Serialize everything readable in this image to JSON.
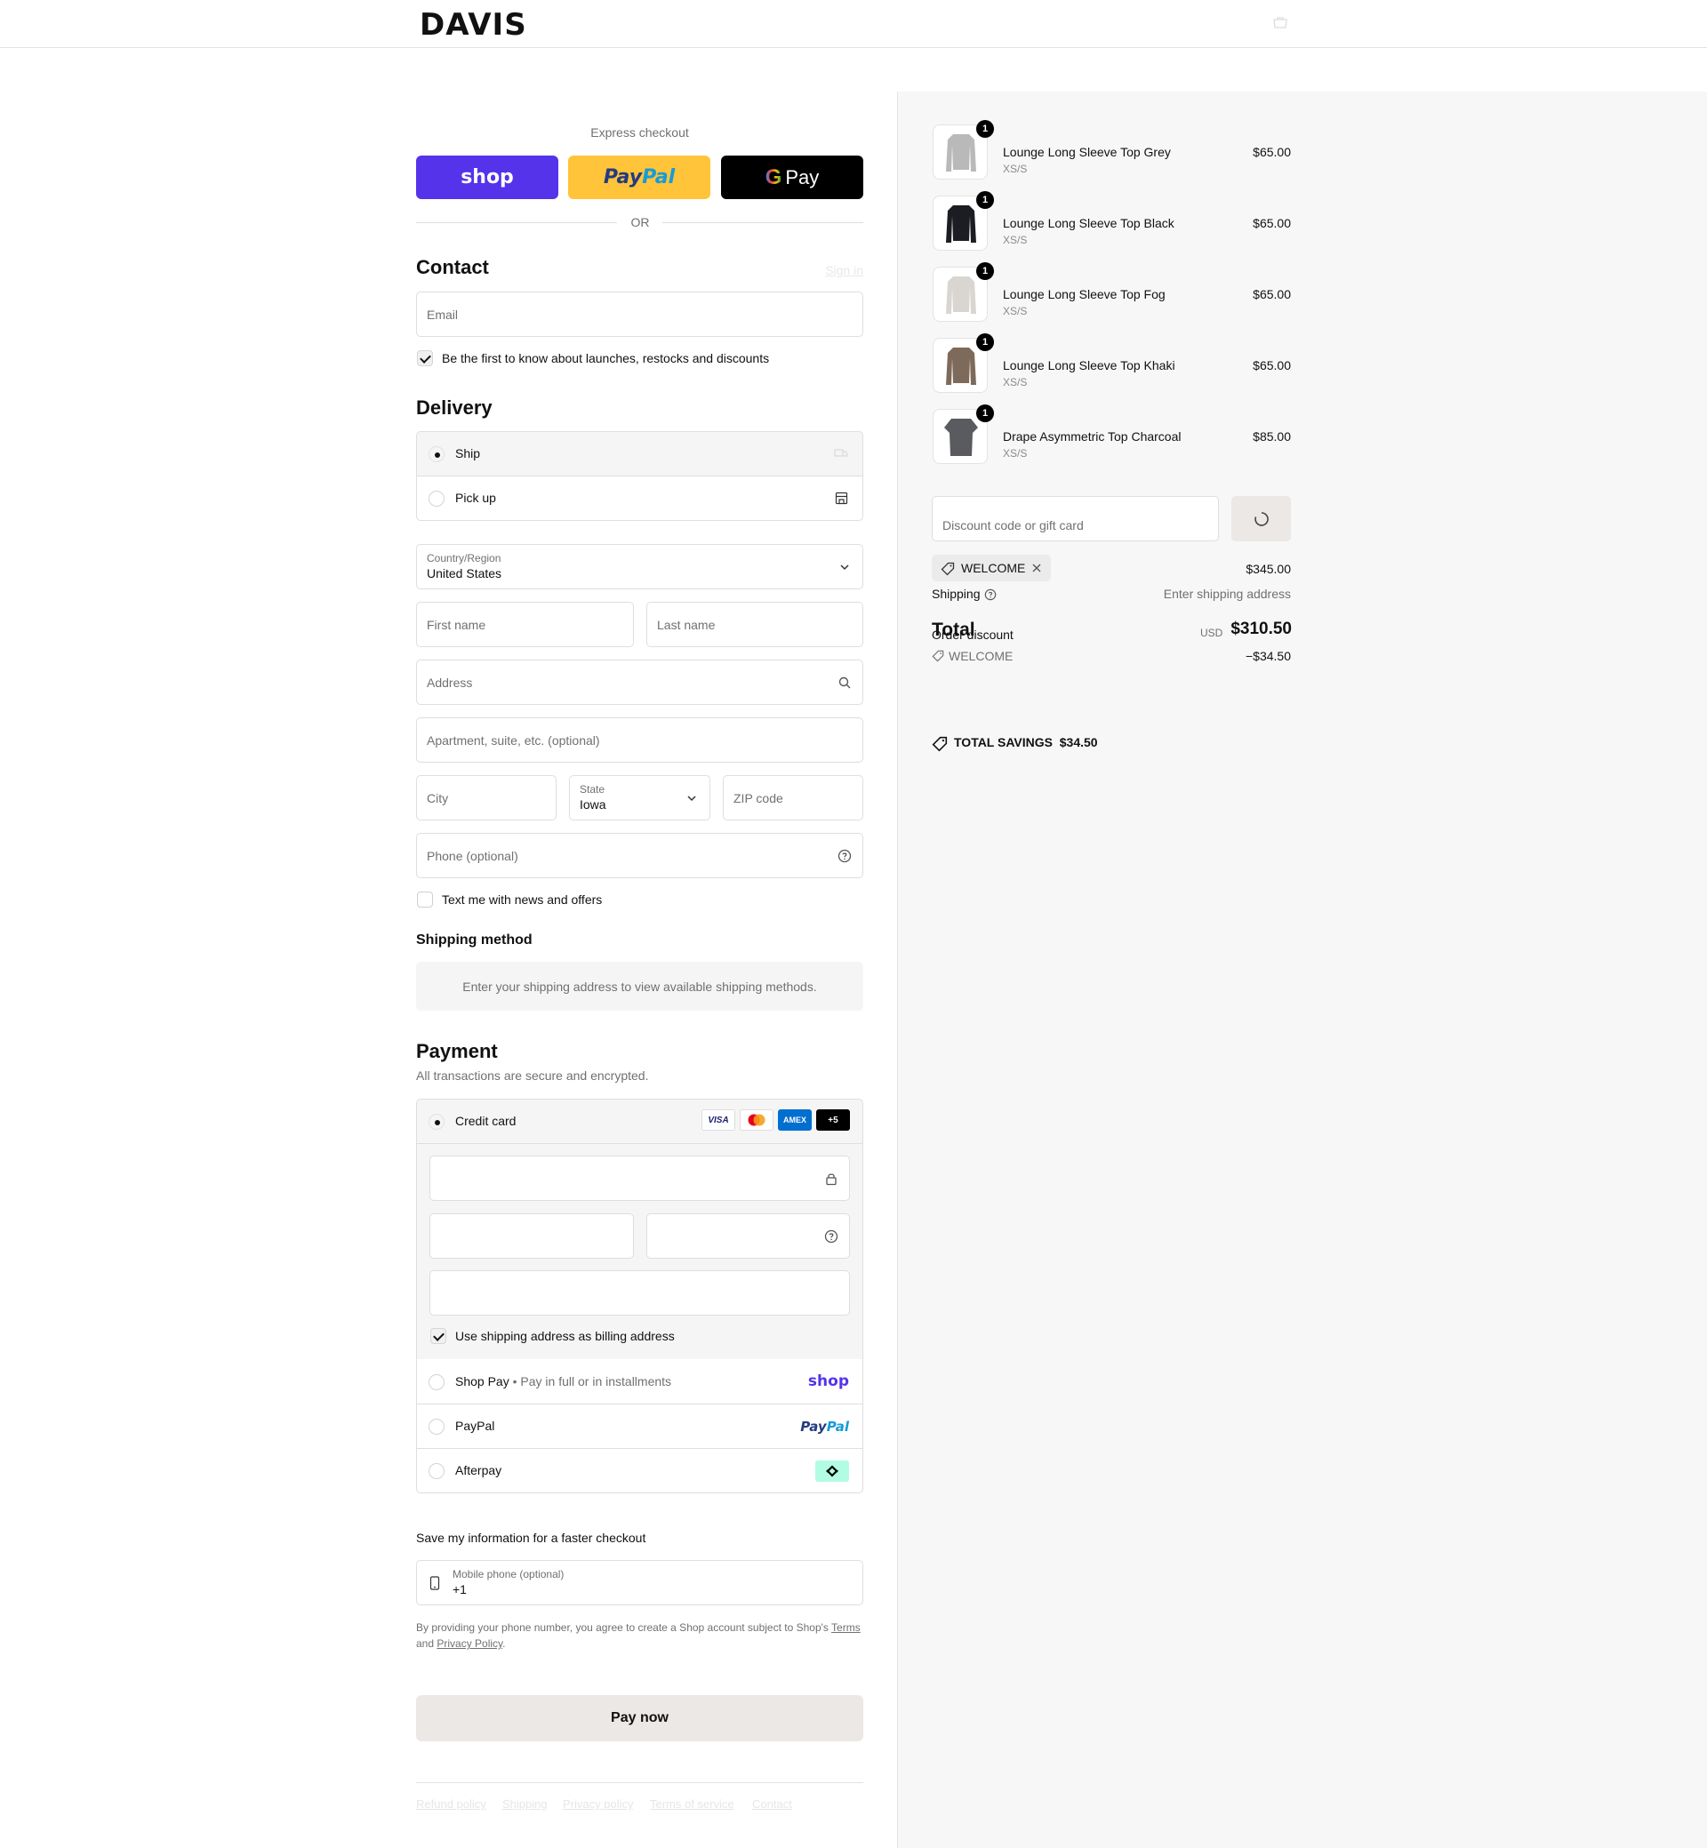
{
  "brand": "DAVIS",
  "express": {
    "title": "Express checkout",
    "shop_label": "shop",
    "paypal_label_1": "Pay",
    "paypal_label_2": "Pal",
    "gpay_g": "G",
    "gpay_label": "Pay",
    "or": "OR"
  },
  "contact": {
    "heading": "Contact",
    "sign_in": "Sign in",
    "email_placeholder": "Email",
    "newsletter_label": "Be the first to know about launches, restocks and discounts",
    "newsletter_checked": true
  },
  "delivery": {
    "heading": "Delivery",
    "options": [
      {
        "label": "Ship",
        "selected": true,
        "icon": "truck-icon"
      },
      {
        "label": "Pick up",
        "selected": false,
        "icon": "store-icon"
      }
    ],
    "country_label": "Country/Region",
    "country_value": "United States",
    "first_name_placeholder": "First name",
    "last_name_placeholder": "Last name",
    "address_placeholder": "Address",
    "apartment_placeholder": "Apartment, suite, etc. (optional)",
    "city_placeholder": "City",
    "state_label": "State",
    "state_value": "Iowa",
    "zip_placeholder": "ZIP code",
    "phone_placeholder": "Phone (optional)",
    "sms_label": "Text me with news and offers",
    "sms_checked": false
  },
  "shipping_method": {
    "heading": "Shipping method",
    "notice": "Enter your shipping address to view available shipping methods."
  },
  "payment": {
    "heading": "Payment",
    "subtitle": "All transactions are secure and encrypted.",
    "credit_card_label": "Credit card",
    "card_brands": [
      "VISA",
      "mastercard",
      "AMEX",
      "+5"
    ],
    "billing_same_label": "Use shipping address as billing address",
    "billing_same_checked": true,
    "shop_pay_label": "Shop Pay",
    "shop_pay_sub": "Pay in full or in installments",
    "shop_pay_logo": "shop",
    "paypal_label": "PayPal",
    "paypal_logo_1": "Pay",
    "paypal_logo_2": "Pal",
    "afterpay_label": "Afterpay",
    "afterpay_icon": "afterpay-icon"
  },
  "save_info": {
    "heading": "Save my information for a faster checkout",
    "mobile_label": "Mobile phone (optional)",
    "mobile_value": "+1",
    "legal_1": "By providing your phone number, you agree to create a Shop account subject to Shop's ",
    "terms": "Terms",
    "legal_2": "and ",
    "privacy": "Privacy Policy",
    "legal_3": "."
  },
  "pay_now": "Pay now",
  "footer_links": [
    "Refund policy",
    "Shipping",
    "Privacy policy",
    "Terms of service",
    "Contact"
  ],
  "summary": {
    "items": [
      {
        "name": "Lounge Long Sleeve Top Grey",
        "variant": "XS/S",
        "price": "$65.00",
        "qty": "1",
        "color": "#b9b9b9"
      },
      {
        "name": "Lounge Long Sleeve Top Black",
        "variant": "XS/S",
        "price": "$65.00",
        "qty": "1",
        "color": "#1b1d22"
      },
      {
        "name": "Lounge Long Sleeve Top Fog",
        "variant": "XS/S",
        "price": "$65.00",
        "qty": "1",
        "color": "#d9d5d0"
      },
      {
        "name": "Lounge Long Sleeve Top Khaki",
        "variant": "XS/S",
        "price": "$65.00",
        "qty": "1",
        "color": "#7d6a5a"
      },
      {
        "name": "Drape Asymmetric Top Charcoal",
        "variant": "XS/S",
        "price": "$85.00",
        "qty": "1",
        "color": "#5a5b5e"
      }
    ],
    "discount_placeholder": "Discount code or gift card",
    "applied_code": "WELCOME",
    "subtotal_value": "$345.00",
    "shipping_label": "Shipping",
    "shipping_value": "Enter shipping address",
    "total_label": "Total",
    "currency": "USD",
    "total_value": "$310.50",
    "order_discount_label": "Order discount",
    "discount_code": "WELCOME",
    "discount_value": "−$34.50",
    "savings_label": "TOTAL SAVINGS",
    "savings_value": "$34.50"
  }
}
